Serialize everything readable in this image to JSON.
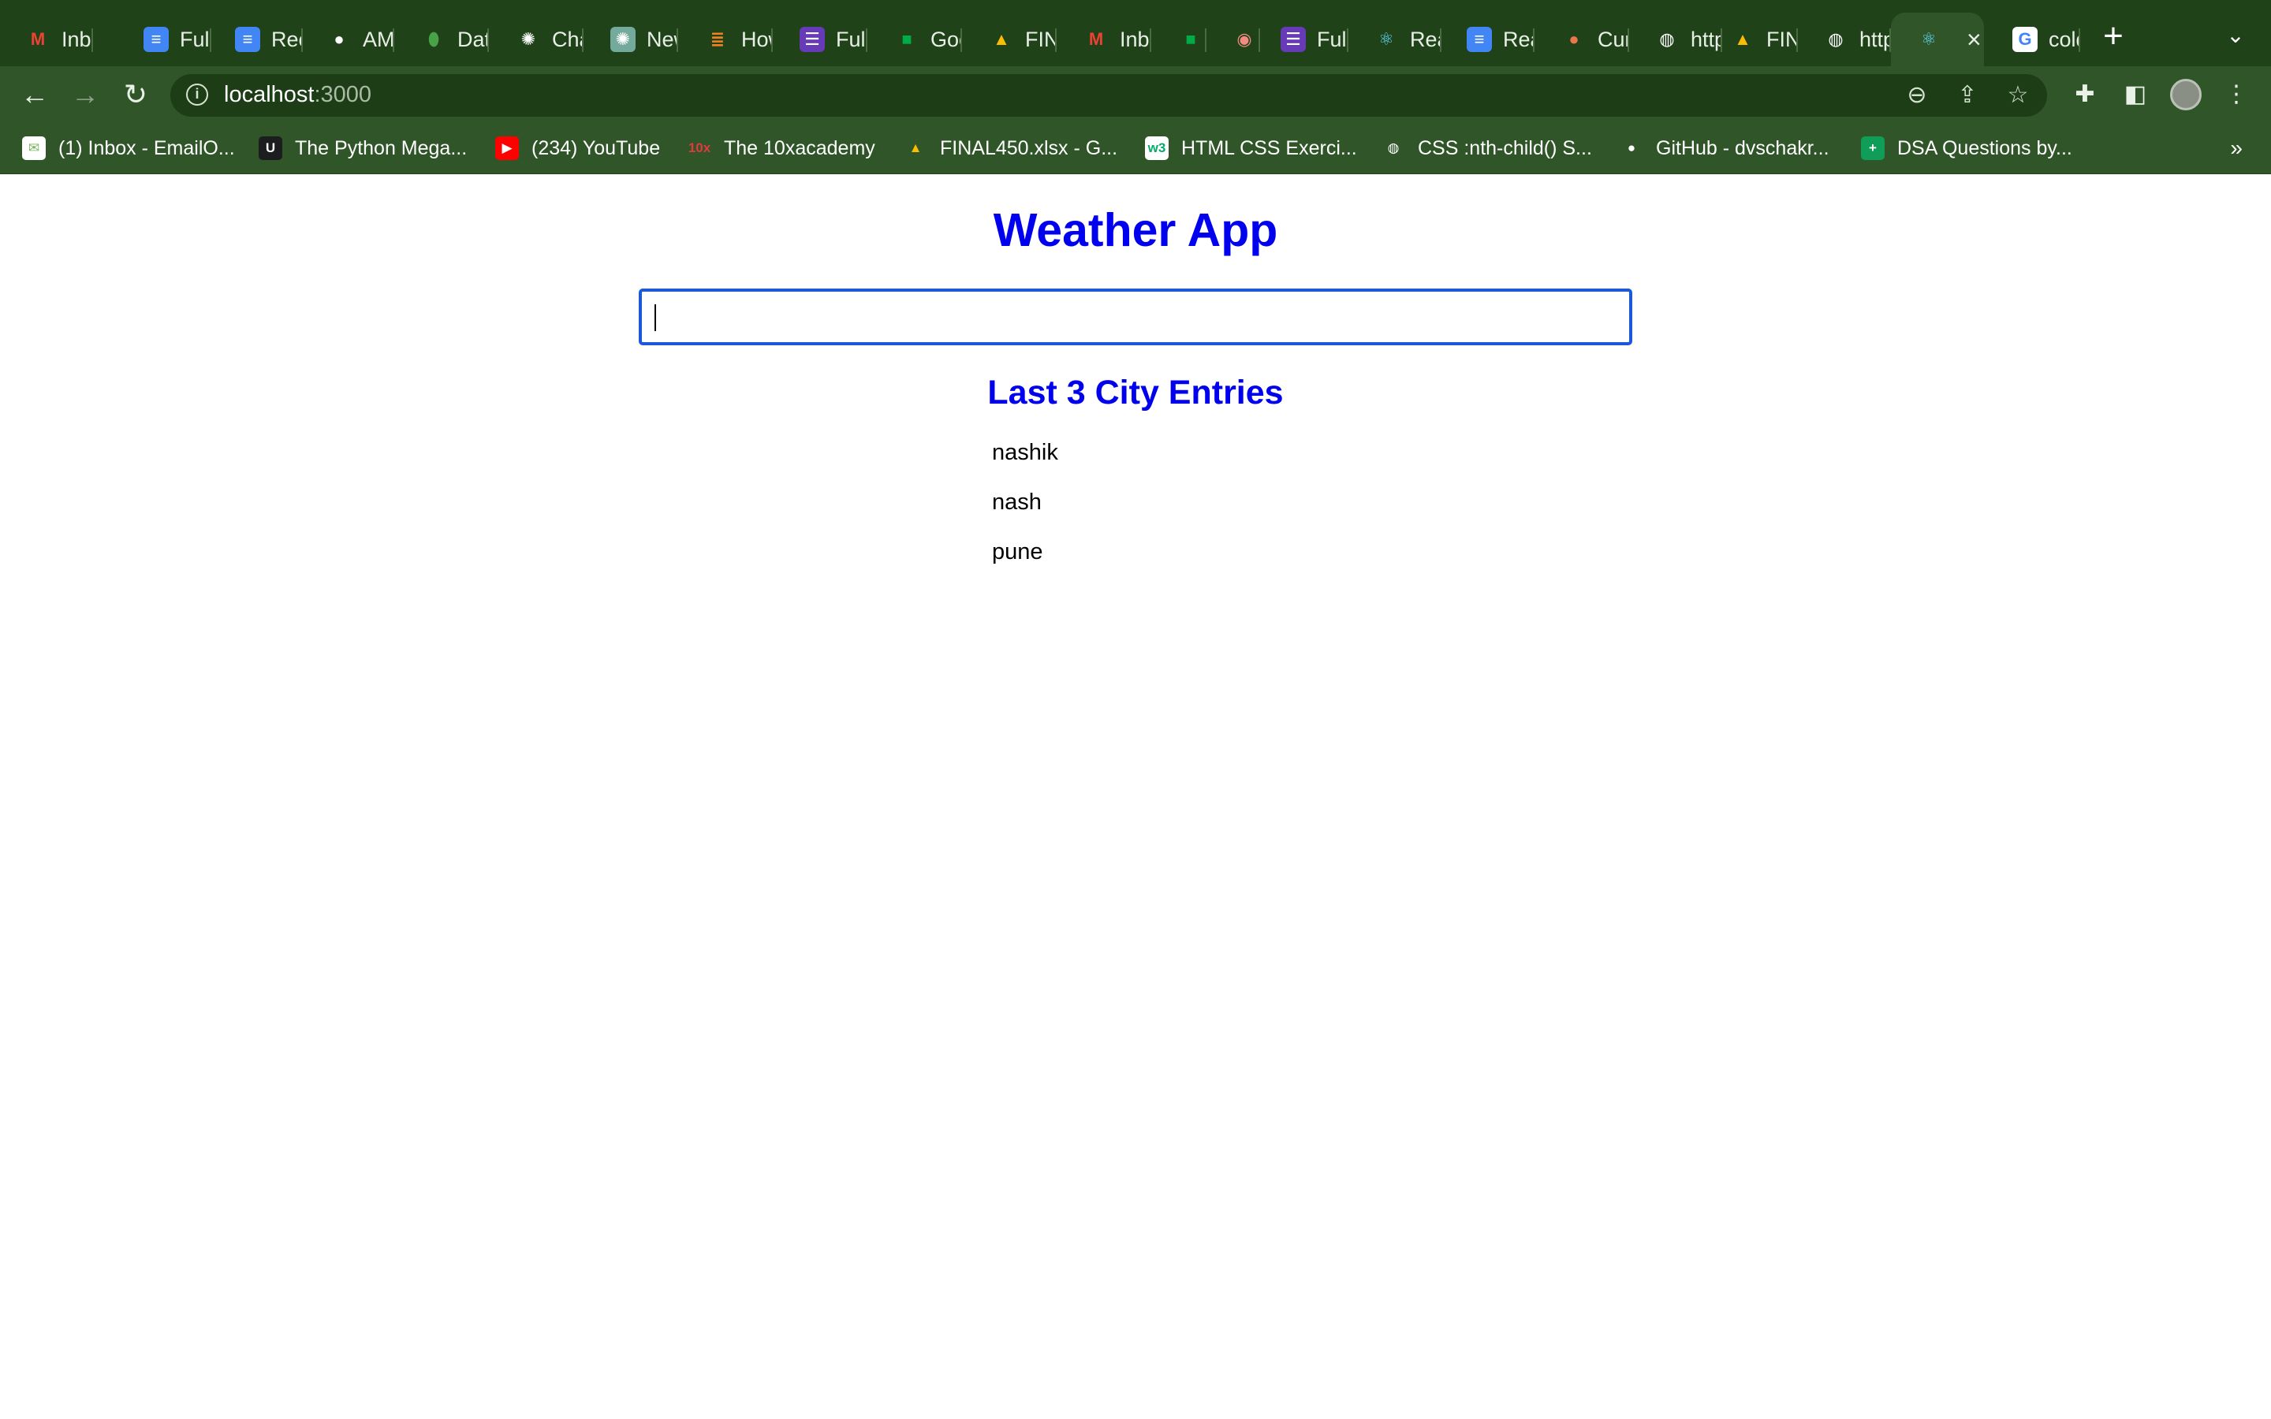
{
  "tabs": [
    {
      "label": "Inbox",
      "icon": "gmail-icon",
      "glyph": "M",
      "color": "#ea4335",
      "bg": "transparent"
    },
    {
      "label": "Full",
      "icon": "docs-icon",
      "glyph": "≡",
      "color": "#ffffff",
      "bg": "#4285f4"
    },
    {
      "label": "Rec",
      "icon": "docs-icon",
      "glyph": "≡",
      "color": "#ffffff",
      "bg": "#4285f4"
    },
    {
      "label": "AM",
      "icon": "github-icon",
      "glyph": "●",
      "color": "#ffffff",
      "bg": "transparent"
    },
    {
      "label": "Dat",
      "icon": "mongodb-icon",
      "glyph": "⬮",
      "color": "#47a248",
      "bg": "transparent"
    },
    {
      "label": "Cha",
      "icon": "openai-icon",
      "glyph": "✺",
      "color": "#ffffff",
      "bg": "transparent"
    },
    {
      "label": "New",
      "icon": "openai-icon",
      "glyph": "✺",
      "color": "#ffffff",
      "bg": "#74aa9c"
    },
    {
      "label": "How",
      "icon": "stackoverflow-icon",
      "glyph": "≣",
      "color": "#f48024",
      "bg": "transparent"
    },
    {
      "label": "Full",
      "icon": "forms-icon",
      "glyph": "☰",
      "color": "#ffffff",
      "bg": "#673ab7"
    },
    {
      "label": "Goo",
      "icon": "meet-icon",
      "glyph": "■",
      "color": "#00ac47",
      "bg": "transparent"
    },
    {
      "label": "FIN",
      "icon": "drive-icon",
      "glyph": "▲",
      "color": "#fbbc04",
      "bg": "transparent"
    },
    {
      "label": "Inb",
      "icon": "gmail-icon",
      "glyph": "M",
      "color": "#ea4335",
      "bg": "transparent"
    },
    {
      "label": "",
      "icon": "meet-icon",
      "glyph": "■",
      "color": "#00ac47",
      "bg": "transparent"
    },
    {
      "label": "",
      "icon": "record-icon",
      "glyph": "◉",
      "color": "#f28b82",
      "bg": "transparent"
    },
    {
      "label": "Full",
      "icon": "forms-icon",
      "glyph": "☰",
      "color": "#ffffff",
      "bg": "#673ab7"
    },
    {
      "label": "Rea",
      "icon": "react-icon",
      "glyph": "⚛",
      "color": "#61dafb",
      "bg": "transparent"
    },
    {
      "label": "Rea",
      "icon": "docs-icon",
      "glyph": "≡",
      "color": "#ffffff",
      "bg": "#4285f4"
    },
    {
      "label": "Cur",
      "icon": "mushroom-icon",
      "glyph": "●",
      "color": "#e8784a",
      "bg": "transparent"
    },
    {
      "label": "http",
      "icon": "globe-icon",
      "glyph": "◍",
      "color": "#ffffff",
      "bg": "transparent"
    },
    {
      "label": "FIN",
      "icon": "drive-icon",
      "glyph": "▲",
      "color": "#fbbc04",
      "bg": "transparent"
    },
    {
      "label": "http",
      "icon": "globe-icon",
      "glyph": "◍",
      "color": "#ffffff",
      "bg": "transparent"
    },
    {
      "label": "",
      "icon": "react-icon",
      "glyph": "⚛",
      "color": "#61dafb",
      "bg": "transparent",
      "active": true
    },
    {
      "label": "cold",
      "icon": "google-icon",
      "glyph": "G",
      "color": "#4285f4",
      "bg": "#ffffff"
    }
  ],
  "toolbar": {
    "url_host": "localhost",
    "url_port": ":3000"
  },
  "bookmarks": [
    {
      "label": "(1) Inbox - EmailO...",
      "icon": "email-icon",
      "glyph": "✉",
      "color": "#7ab55c",
      "bg": "#ffffff"
    },
    {
      "label": "The Python Mega...",
      "icon": "udemy-icon",
      "glyph": "U",
      "color": "#ffffff",
      "bg": "#1c1d1f"
    },
    {
      "label": "(234) YouTube",
      "icon": "youtube-icon",
      "glyph": "▶",
      "color": "#ffffff",
      "bg": "#ff0000"
    },
    {
      "label": "The 10xacademy",
      "icon": "tenx-icon",
      "glyph": "10x",
      "color": "#e0393e",
      "bg": "transparent"
    },
    {
      "label": "FINAL450.xlsx - G...",
      "icon": "drive-icon",
      "glyph": "▲",
      "color": "#fbbc04",
      "bg": "transparent"
    },
    {
      "label": "HTML CSS Exerci...",
      "icon": "w3schools-icon",
      "glyph": "w3",
      "color": "#04aa6d",
      "bg": "#ffffff"
    },
    {
      "label": "CSS :nth-child() S...",
      "icon": "globe-icon",
      "glyph": "◍",
      "color": "#ffffff",
      "bg": "transparent"
    },
    {
      "label": "GitHub - dvschakr...",
      "icon": "github-icon",
      "glyph": "●",
      "color": "#ffffff",
      "bg": "transparent"
    },
    {
      "label": "DSA Questions by...",
      "icon": "sheets-icon",
      "glyph": "+",
      "color": "#ffffff",
      "bg": "#0f9d58"
    }
  ],
  "page": {
    "title": "Weather App",
    "search_placeholder": "",
    "search_value": "",
    "entries_heading": "Last 3 City Entries",
    "entries": [
      "nashik",
      "nash",
      "pune"
    ]
  },
  "colors": {
    "heading": "#0000ee",
    "input_focus_border": "#1a5ad8",
    "chrome_dark": "#204219",
    "chrome_toolbar": "#2f5528"
  }
}
